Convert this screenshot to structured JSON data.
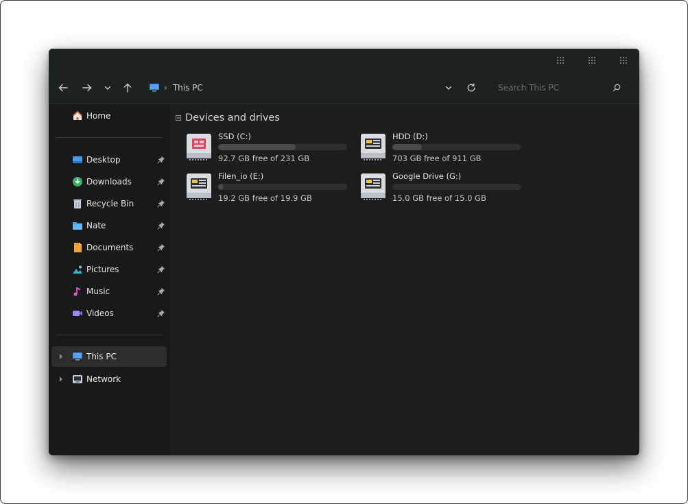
{
  "toolbar": {
    "breadcrumb_separator": "›",
    "location": "This PC",
    "search_placeholder": "Search This PC"
  },
  "sidebar": {
    "home": {
      "label": "Home",
      "icon": "home-icon"
    },
    "quick_access": [
      {
        "label": "Desktop",
        "icon": "desktop-icon",
        "pinned": true
      },
      {
        "label": "Downloads",
        "icon": "downloads-icon",
        "pinned": true
      },
      {
        "label": "Recycle Bin",
        "icon": "recycle-bin-icon",
        "pinned": true
      },
      {
        "label": "Nate",
        "icon": "folder-icon",
        "pinned": true
      },
      {
        "label": "Documents",
        "icon": "documents-icon",
        "pinned": true
      },
      {
        "label": "Pictures",
        "icon": "pictures-icon",
        "pinned": true
      },
      {
        "label": "Music",
        "icon": "music-icon",
        "pinned": true
      },
      {
        "label": "Videos",
        "icon": "videos-icon",
        "pinned": true
      }
    ],
    "this_pc": {
      "label": "This PC",
      "icon": "computer-icon",
      "selected": true
    },
    "network": {
      "label": "Network",
      "icon": "network-icon"
    }
  },
  "main": {
    "section_title": "Devices and drives",
    "drives": [
      {
        "name": "SSD (C:)",
        "free": "92.7 GB free of 231 GB",
        "used_fraction": 0.599,
        "icon": "ssd-drive-icon"
      },
      {
        "name": "HDD (D:)",
        "free": "703 GB free of 911 GB",
        "used_fraction": 0.228,
        "icon": "hdd-drive-icon"
      },
      {
        "name": "Filen_io (E:)",
        "free": "19.2 GB free of 19.9 GB",
        "used_fraction": 0.035,
        "icon": "cloud-drive-icon"
      },
      {
        "name": "Google Drive (G:)",
        "free": "15.0 GB free of 15.0 GB",
        "used_fraction": 0.0,
        "icon": "cloud-drive-icon"
      }
    ]
  },
  "colors": {
    "window_bg": "#1b1b1b",
    "titlebar_bg": "#1c2220",
    "sidebar_bg": "#191919",
    "text": "#e6e6e6"
  }
}
